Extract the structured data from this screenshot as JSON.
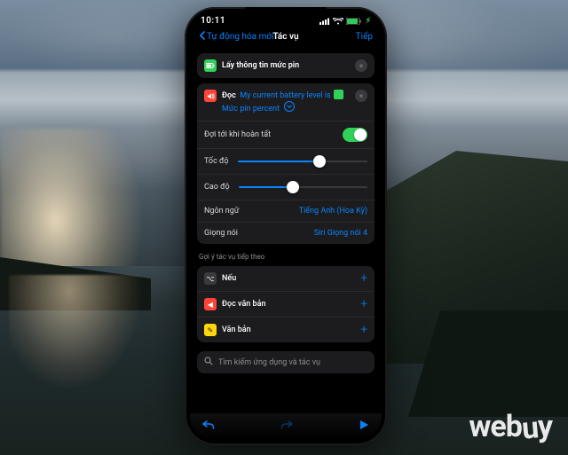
{
  "status": {
    "time": "10:11",
    "battery_icon_color": "#34c759"
  },
  "nav": {
    "back": "Tự động hóa mới",
    "title": "Tác vụ",
    "done": "Tiếp"
  },
  "actions": {
    "battery": {
      "label": "Lấy thông tin mức pin"
    },
    "speak": {
      "action_label": "Đọc",
      "text_prefix": "My current battery level is",
      "variable_label": "Mức pin percent",
      "options": {
        "wait": {
          "label": "Đợi tới khi hoàn tất",
          "on": true
        },
        "rate": {
          "label": "Tốc độ",
          "value": 0.63
        },
        "pitch": {
          "label": "Cao độ",
          "value": 0.42
        },
        "language": {
          "label": "Ngôn ngữ",
          "value": "Tiếng Anh (Hoa Kỳ)"
        },
        "voice": {
          "label": "Giọng nói",
          "value": "Siri Giọng nói 4"
        }
      }
    }
  },
  "suggestions": {
    "heading": "Gợi ý tác vụ tiếp theo",
    "items": [
      {
        "icon": "grey",
        "glyph": "⌥",
        "label": "Nếu"
      },
      {
        "icon": "red",
        "glyph": "◀︎",
        "label": "Đọc văn bản"
      },
      {
        "icon": "yellow",
        "glyph": "✎",
        "label": "Văn bản"
      }
    ]
  },
  "search": {
    "placeholder": "Tìm kiếm ứng dụng và tác vụ"
  },
  "watermark": "webuy"
}
